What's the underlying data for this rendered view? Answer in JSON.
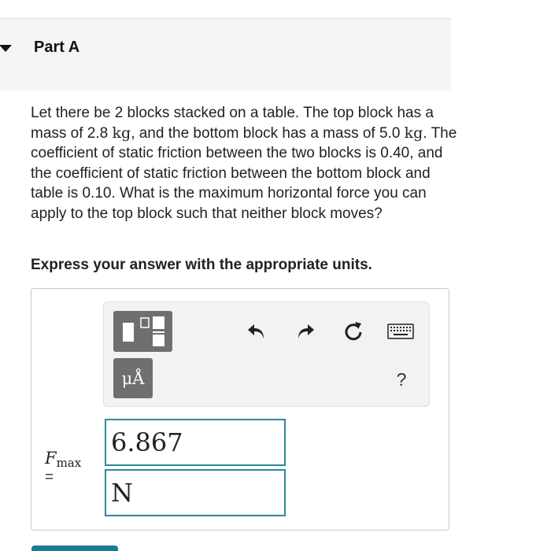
{
  "part": {
    "title": "Part A"
  },
  "question": {
    "text_1": "Let there be 2 blocks stacked on a table. The top block has a mass of 2.8 ",
    "mass_top_unit": "kg",
    "text_2": ", and the bottom block has a mass of 5.0 ",
    "mass_bottom_unit": "kg",
    "text_3": ". The coefficient of static friction between the two blocks is 0.40, and the coefficient of static friction between the bottom block and table is 0.10. What is the maximum horizontal force you can apply to the top block such that neither block moves?"
  },
  "instruction": "Express your answer with the appropriate units.",
  "toolbar": {
    "units_label": "μÅ",
    "help_label": "?"
  },
  "answer": {
    "variable": "F",
    "subscript": "max",
    "equals": "=",
    "value": "6.867",
    "units": "N"
  },
  "colors": {
    "field_border": "#2a8aa0",
    "tool_button": "#6f6f6f",
    "submit_button": "#1d7b96",
    "header_bg": "#f5f5f5"
  },
  "icons": [
    "caret-down-icon",
    "templates-icon",
    "undo-icon",
    "redo-icon",
    "reset-icon",
    "keyboard-icon"
  ]
}
